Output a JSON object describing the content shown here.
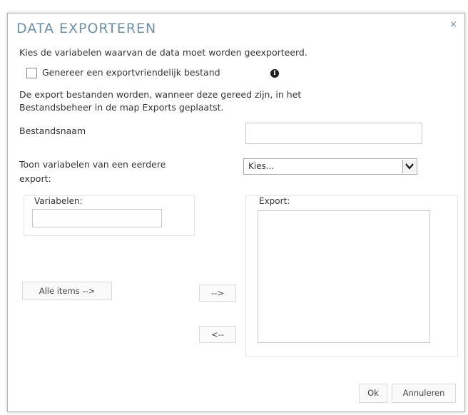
{
  "dialog": {
    "title": "DATA EXPORTEREN",
    "close_icon": "×",
    "intro": "Kies de variabelen waarvan de data moet worden geexporteerd.",
    "checkbox_label": "Genereer een exportvriendelijk bestand",
    "info_icon": "i",
    "note_line1": "De export bestanden worden, wanneer deze gereed zijn, in het",
    "note_line2": "Bestandsbeheer in de map Exports geplaatst.",
    "filename_label": "Bestandsnaam",
    "filename_value": "",
    "previous_label_line1": "Toon variabelen van een eerdere",
    "previous_label_line2": "export:",
    "previous_select_value": "Kies...",
    "variables_label": "Variabelen:",
    "variables_value": "",
    "export_label": "Export:",
    "all_items_button": "Alle items -->",
    "add_button": "-->",
    "remove_button": "<--",
    "ok_button": "Ok",
    "cancel_button": "Annuleren"
  },
  "icons": [
    "close-icon",
    "info-icon",
    "chevron-down-icon"
  ]
}
